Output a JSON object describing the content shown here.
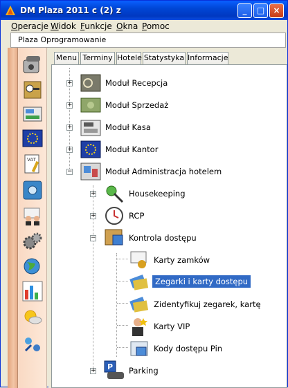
{
  "window": {
    "title": "DM Plaza 2011 c (2) z"
  },
  "window_buttons": {
    "minimize": "_",
    "maximize": "□",
    "close": "×"
  },
  "menubar": [
    {
      "first": "O",
      "rest": "peracje"
    },
    {
      "first": "W",
      "rest": "idok"
    },
    {
      "first": "F",
      "rest": "unkcje"
    },
    {
      "first": "O",
      "rest": "kna"
    },
    {
      "first": "P",
      "rest": "omoc"
    }
  ],
  "address": {
    "text": "Plaza Oprogramowanie"
  },
  "tabs": [
    "Menu",
    "Terminy",
    "Hotele",
    "Statystyka",
    "Informacje"
  ],
  "tree": {
    "recepcja": "Moduł Recepcja",
    "sprzedaz": "Moduł Sprzedaż",
    "kasa": "Moduł Kasa",
    "kantor": "Moduł Kantor",
    "administracja": "Moduł Administracja hotelem",
    "housekeeping": "Housekeeping",
    "rcp": "RCP",
    "kontrola": "Kontrola dostępu",
    "karty_zamkow": "Karty zamków",
    "zegarki": "Zegarki i karty dostępu",
    "zidentyfikuj": "Zidentyfikuj zegarek, kartę",
    "karty_vip": "Karty VIP",
    "kody": "Kody dostępu Pin",
    "parking": "Parking"
  },
  "expander": {
    "plus": "+",
    "minus": "−"
  },
  "colors": {
    "titlebar": "#0046d5",
    "selection": "#316ac5",
    "sidebar": "#f2c6a6"
  }
}
